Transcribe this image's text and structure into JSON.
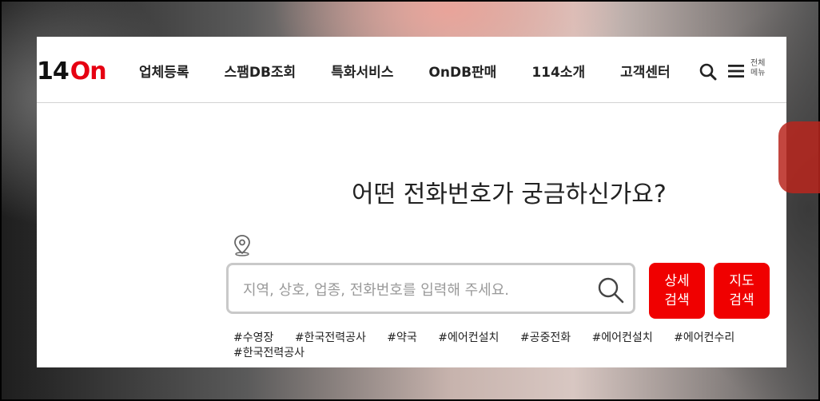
{
  "brand": {
    "logo_num": "14",
    "logo_on": "On",
    "accent": "#e60012"
  },
  "nav": {
    "items": [
      "업체등록",
      "스팸DB조회",
      "특화서비스",
      "OnDB판매",
      "114소개",
      "고객센터"
    ]
  },
  "header": {
    "search_icon": "search-icon",
    "menu_icon": "hamburger-icon",
    "menu_label_line1": "전체",
    "menu_label_line2": "메뉴"
  },
  "main": {
    "headline": "어떤 전화번호가 궁금하신가요?",
    "location_icon": "map-pin-icon",
    "search": {
      "placeholder": "지역, 상호, 업종, 전화번호를 입력해 주세요.",
      "value": ""
    },
    "detail_button": {
      "line1": "상세",
      "line2": "검색"
    },
    "map_button": {
      "line1": "지도",
      "line2": "검색"
    },
    "button_color": "#f00000",
    "tags": [
      "#수영장",
      "#한국전력공사",
      "#약국",
      "#에어컨설치",
      "#공중전화",
      "#에어컨설치",
      "#에어컨수리",
      "#한국전력공사"
    ]
  }
}
